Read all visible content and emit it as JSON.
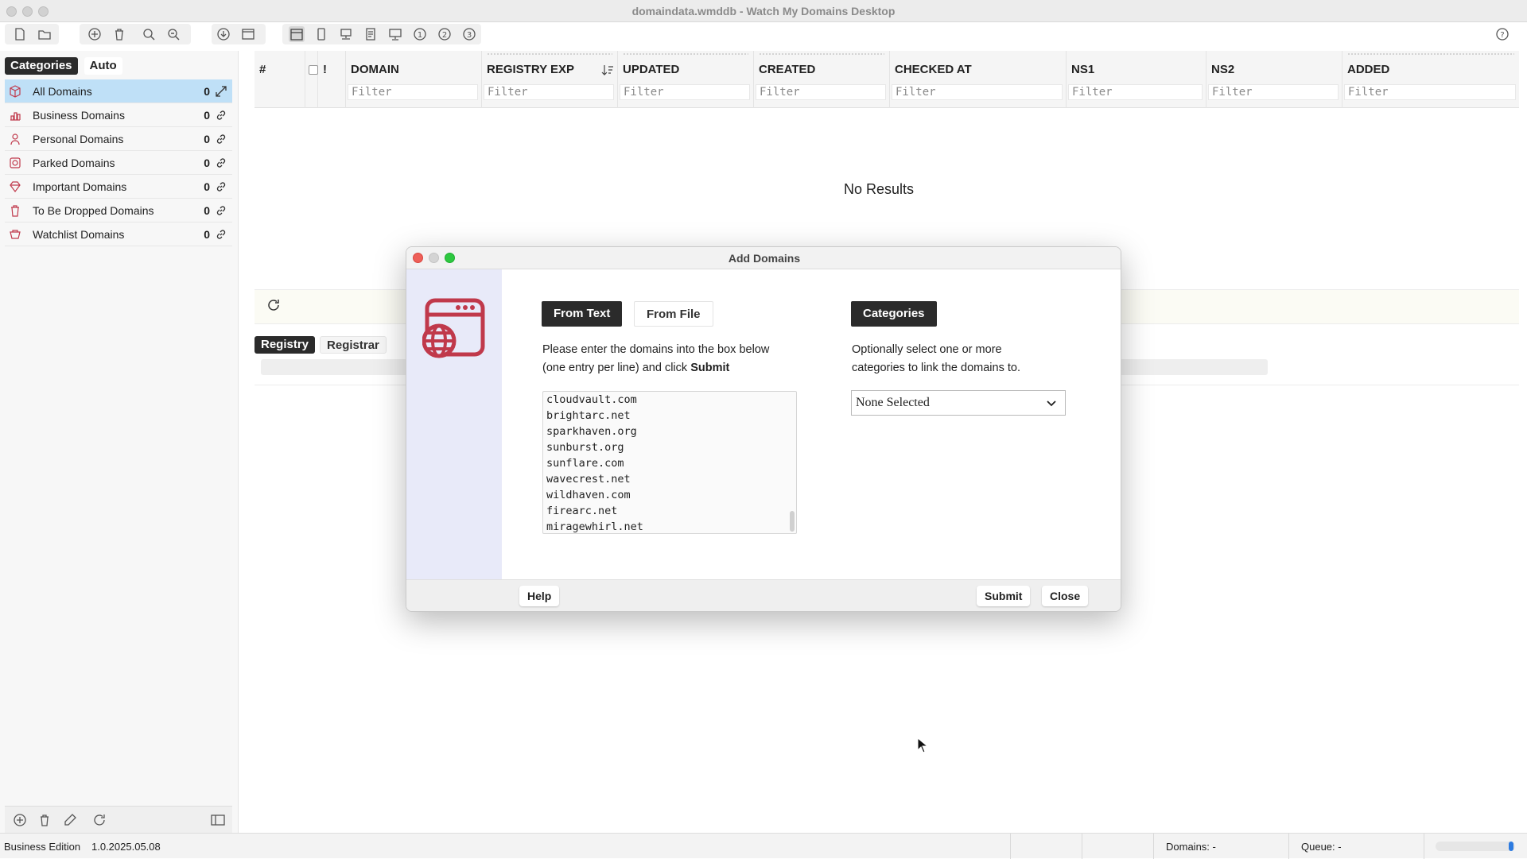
{
  "window": {
    "title": "domaindata.wmddb - Watch My Domains Desktop"
  },
  "sidebar": {
    "tabs": [
      "Categories",
      "Auto"
    ],
    "categories": [
      {
        "label": "All Domains",
        "count": "0",
        "icon": "cube-icon"
      },
      {
        "label": "Business Domains",
        "count": "0",
        "icon": "chart-icon"
      },
      {
        "label": "Personal Domains",
        "count": "0",
        "icon": "person-icon"
      },
      {
        "label": "Parked Domains",
        "count": "0",
        "icon": "parking-icon"
      },
      {
        "label": "Important Domains",
        "count": "0",
        "icon": "gem-icon"
      },
      {
        "label": "To Be Dropped Domains",
        "count": "0",
        "icon": "trash-icon"
      },
      {
        "label": "Watchlist Domains",
        "count": "0",
        "icon": "watch-icon"
      }
    ]
  },
  "grid": {
    "columns": [
      {
        "title": "#"
      },
      {
        "title": "!"
      },
      {
        "title": "DOMAIN",
        "filter": "Filter"
      },
      {
        "title": "REGISTRY EXP",
        "filter": "Filter"
      },
      {
        "title": "UPDATED",
        "filter": "Filter"
      },
      {
        "title": "CREATED",
        "filter": "Filter"
      },
      {
        "title": "CHECKED AT",
        "filter": "Filter"
      },
      {
        "title": "NS1",
        "filter": "Filter"
      },
      {
        "title": "NS2",
        "filter": "Filter"
      },
      {
        "title": "ADDED",
        "filter": "Filter"
      }
    ],
    "empty_text": "No Results"
  },
  "detail": {
    "tabs": [
      "Registry",
      "Registrar"
    ]
  },
  "dialog": {
    "title": "Add Domains",
    "tabs": {
      "from_text": "From Text",
      "from_file": "From File",
      "categories": "Categories"
    },
    "instructions_line1": "Please enter the domains into the box below",
    "instructions_line2_prefix": "(one entry per line) and click",
    "instructions_line2_bold": "Submit",
    "categories_line1": "Optionally select one or more",
    "categories_line2": "categories to link the domains to.",
    "domains": [
      "cloudvault.com",
      "brightarc.net",
      "sparkhaven.org",
      "sunburst.org",
      "sunflare.com",
      "wavecrest.net",
      "wildhaven.com",
      "firearc.net",
      "miragewhirl.net"
    ],
    "category_select": "None Selected",
    "buttons": {
      "help": "Help",
      "submit": "Submit",
      "close": "Close"
    }
  },
  "statusbar": {
    "edition": "Business Edition",
    "version": "1.0.2025.05.08",
    "domains": "Domains: -",
    "queue": "Queue: -"
  },
  "colors": {
    "selected_row": "#bfe0f7",
    "dark_tab": "#2b2b2b",
    "dialog_side": "#e8eaf9",
    "category_icon": "#c0394b",
    "progress": "#2d7be0"
  }
}
